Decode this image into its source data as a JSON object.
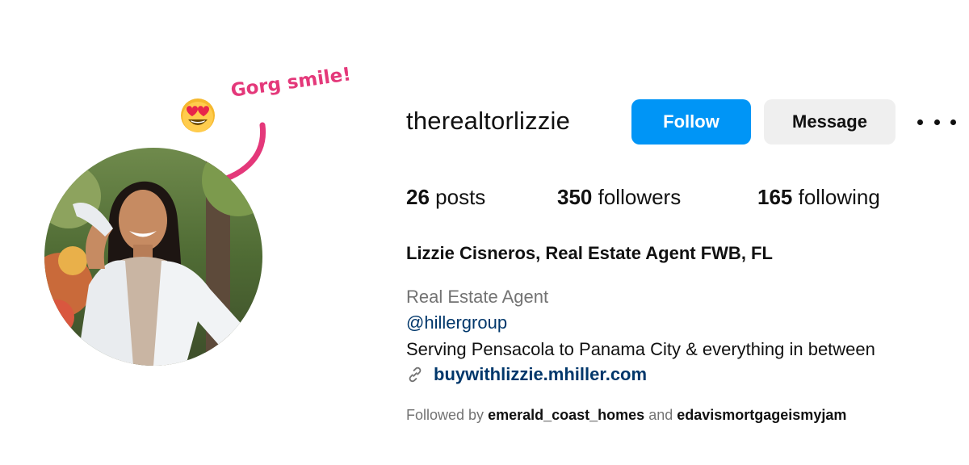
{
  "annotation": {
    "text": "Gorg smile!",
    "emoji_icon": "heart-eyes-emoji",
    "color": "#e4387a"
  },
  "profile": {
    "username": "therealtorlizzie",
    "avatar_icon": "profile-photo",
    "follow_label": "Follow",
    "message_label": "Message",
    "more_icon": "more-options-icon",
    "stats": {
      "posts_count": "26",
      "posts_label": "posts",
      "followers_count": "350",
      "followers_label": "followers",
      "following_count": "165",
      "following_label": "following"
    },
    "full_name": "Lizzie Cisneros, Real Estate Agent FWB, FL",
    "category": "Real Estate Agent",
    "mention": "@hillergroup",
    "bio": "Serving Pensacola to Panama City & everything in between",
    "link_icon": "link-icon",
    "link": "buywithlizzie.mhiller.com",
    "followed_by": {
      "prefix": "Followed by",
      "user1": "emerald_coast_homes",
      "conjunction": "and",
      "user2": "edavismortgageismyjam"
    }
  },
  "colors": {
    "follow_button": "#0095f6",
    "message_button": "#efefef",
    "link_text": "#00376b",
    "secondary_text": "#737373"
  }
}
